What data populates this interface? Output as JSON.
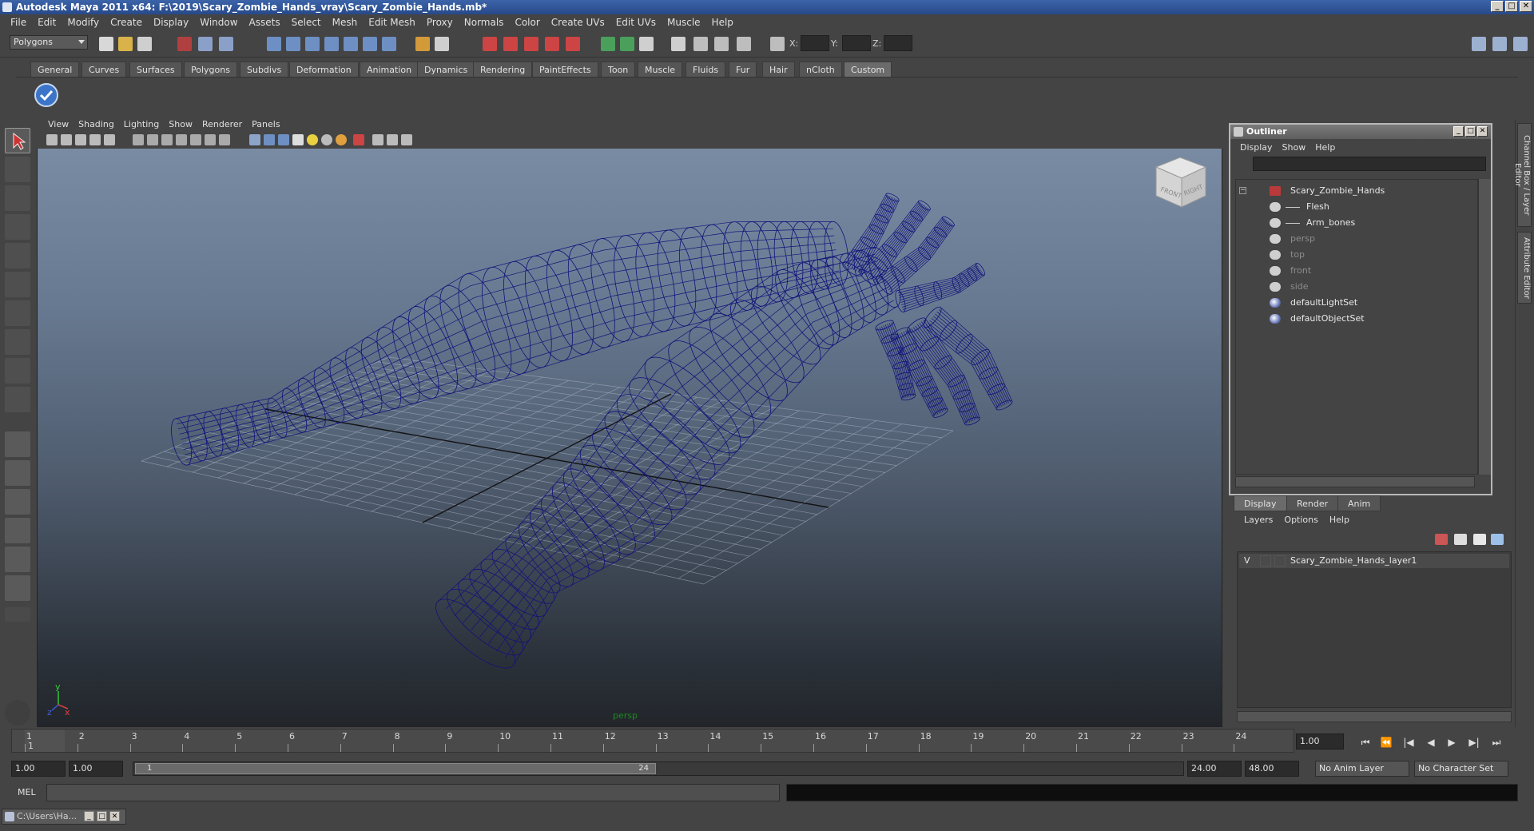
{
  "window": {
    "title": "Autodesk Maya 2011 x64: F:\\2019\\Scary_Zombie_Hands_vray\\Scary_Zombie_Hands.mb*",
    "controls": [
      "_",
      "□",
      "✕"
    ]
  },
  "menubar": [
    "File",
    "Edit",
    "Modify",
    "Create",
    "Display",
    "Window",
    "Assets",
    "Select",
    "Mesh",
    "Edit Mesh",
    "Proxy",
    "Normals",
    "Color",
    "Create UVs",
    "Edit UVs",
    "Muscle",
    "Help"
  ],
  "statusline": {
    "mode": "Polygons",
    "x_label": "X:",
    "y_label": "Y:",
    "z_label": "Z:"
  },
  "shelf": {
    "tabs": [
      "General",
      "Curves",
      "Surfaces",
      "Polygons",
      "Subdivs",
      "Deformation",
      "Animation",
      "Dynamics",
      "Rendering",
      "PaintEffects",
      "Toon",
      "Muscle",
      "Fluids",
      "Fur",
      "Hair",
      "nCloth",
      "Custom"
    ],
    "active_tab": "Custom"
  },
  "viewport": {
    "menu": [
      "View",
      "Shading",
      "Lighting",
      "Show",
      "Renderer",
      "Panels"
    ],
    "camera_label": "persp",
    "viewcube_front": "FRONT",
    "viewcube_right": "RIGHT",
    "axis_y": "y",
    "axis_z": "z",
    "axis_x": "x",
    "wire_color": "#12127a"
  },
  "outliner": {
    "title": "Outliner",
    "menu": [
      "Display",
      "Show",
      "Help"
    ],
    "items": [
      {
        "label": "Scary_Zombie_Hands",
        "kind": "transform",
        "dim": false
      },
      {
        "label": "Flesh",
        "kind": "mesh",
        "dim": false
      },
      {
        "label": "Arm_bones",
        "kind": "mesh",
        "dim": false
      },
      {
        "label": "persp",
        "kind": "camera",
        "dim": true
      },
      {
        "label": "top",
        "kind": "camera",
        "dim": true
      },
      {
        "label": "front",
        "kind": "camera",
        "dim": true
      },
      {
        "label": "side",
        "kind": "camera",
        "dim": true
      },
      {
        "label": "defaultLightSet",
        "kind": "set",
        "dim": false
      },
      {
        "label": "defaultObjectSet",
        "kind": "set",
        "dim": false
      }
    ]
  },
  "layer_editor": {
    "tabs": [
      "Display",
      "Render",
      "Anim"
    ],
    "active_tab": "Display",
    "menu": [
      "Layers",
      "Options",
      "Help"
    ],
    "layers": [
      {
        "visible": "V",
        "name": "Scary_Zombie_Hands_layer1"
      }
    ]
  },
  "side_tabs": [
    "Channel Box / Layer Editor",
    "Attribute Editor"
  ],
  "timeline": {
    "frames": [
      "1",
      "2",
      "3",
      "4",
      "5",
      "6",
      "7",
      "8",
      "9",
      "10",
      "11",
      "12",
      "13",
      "14",
      "15",
      "16",
      "17",
      "18",
      "19",
      "20",
      "21",
      "22",
      "23",
      "24"
    ],
    "current_frame_marker": "1",
    "current_frame": "1.00",
    "playback_buttons": [
      "⏮",
      "⏪",
      "|◀",
      "◀",
      "▶",
      "▶|",
      "⏭"
    ]
  },
  "range": {
    "start": "1.00",
    "playback_start": "1.00",
    "thumb_start": "1",
    "thumb_end": "24",
    "playback_end": "24.00",
    "end": "48.00",
    "anim_layer": "No Anim Layer",
    "character_set": "No Character Set"
  },
  "command_line": {
    "label": "MEL"
  },
  "taskbar": {
    "item": "C:\\Users\\Ha..."
  }
}
